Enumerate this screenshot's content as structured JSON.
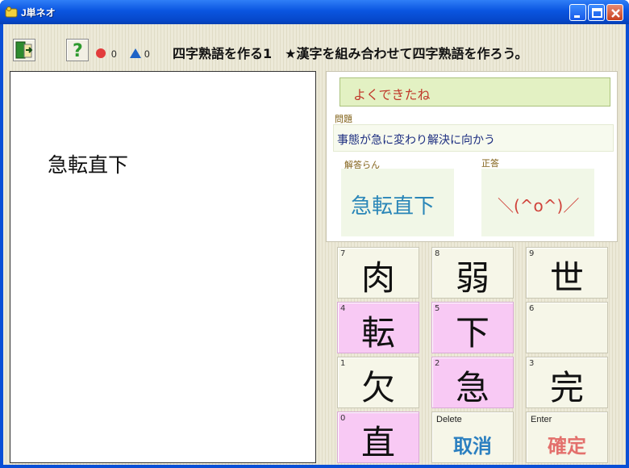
{
  "window": {
    "title": "J単ネオ",
    "controls": {
      "minimize": "minimize-icon",
      "maximize": "maximize-icon",
      "close": "close-icon"
    }
  },
  "toolbar": {
    "exit_icon": "exit-door-icon",
    "help_icon": "question-mark-icon",
    "correct_count": "0",
    "wrong_count": "0",
    "colors": {
      "circle": "#e23c3c",
      "triangle": "#1e63c6"
    },
    "header_text": "四字熟語を作る1　★漢字を組み合わせて四字熟語を作ろう。"
  },
  "left": {
    "word": "急転直下"
  },
  "info": {
    "message": "よくできたね",
    "question_label": "問題",
    "question": "事態が急に変わり解決に向かう",
    "answer_label": "解答らん",
    "answer": "急転直下",
    "correct_label": "正答",
    "correct": "＼(^o^)／"
  },
  "keypad": {
    "keys": [
      {
        "num": "7",
        "char": "肉",
        "selected": false
      },
      {
        "num": "8",
        "char": "弱",
        "selected": false
      },
      {
        "num": "9",
        "char": "世",
        "selected": false
      },
      {
        "num": "4",
        "char": "転",
        "selected": true
      },
      {
        "num": "5",
        "char": "下",
        "selected": true
      },
      {
        "num": "6",
        "char": "",
        "selected": false
      },
      {
        "num": "1",
        "char": "欠",
        "selected": false
      },
      {
        "num": "2",
        "char": "急",
        "selected": true
      },
      {
        "num": "3",
        "char": "完",
        "selected": false
      },
      {
        "num": "0",
        "char": "直",
        "selected": true
      }
    ],
    "delete": {
      "top": "Delete",
      "label": "取消",
      "color": "#2b7fc0"
    },
    "enter": {
      "top": "Enter",
      "label": "確定",
      "color": "#e3706c"
    }
  }
}
